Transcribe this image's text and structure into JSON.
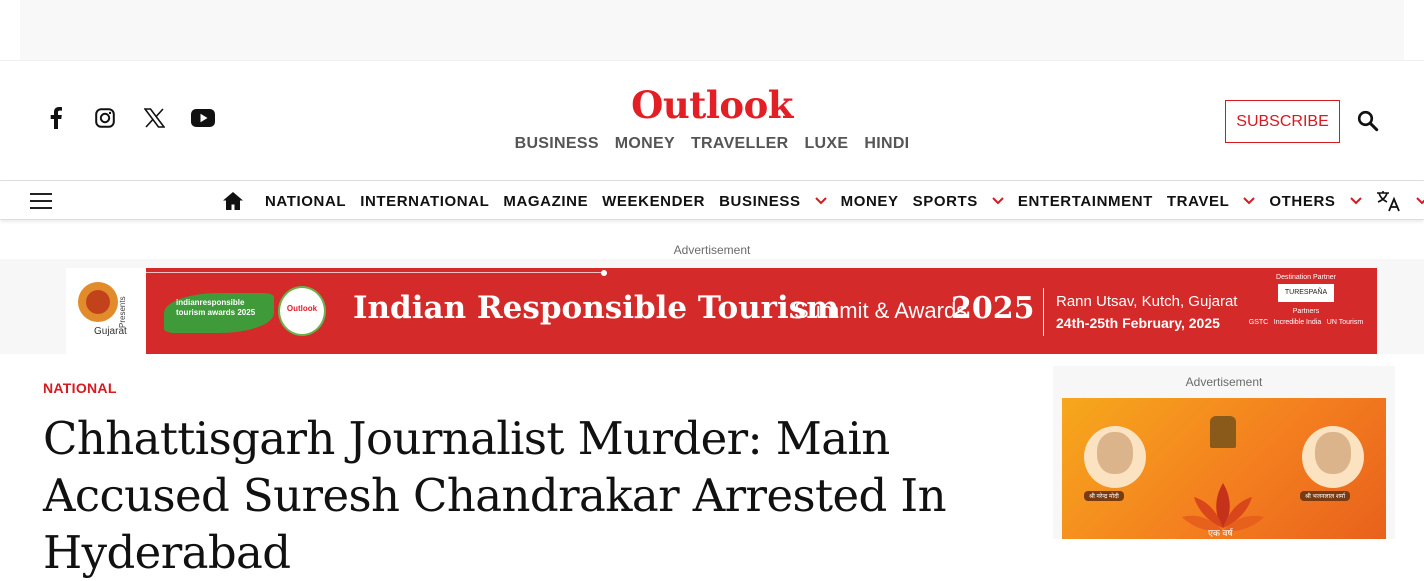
{
  "brand": {
    "logo_text": "Outlook",
    "accent_color": "#e31e24",
    "sub_brands": [
      "BUSINESS",
      "MONEY",
      "TRAVELLER",
      "LUXE",
      "HINDI"
    ]
  },
  "social": {
    "icons": [
      "facebook-icon",
      "instagram-icon",
      "x-icon",
      "youtube-icon"
    ]
  },
  "header": {
    "subscribe_label": "SUBSCRIBE"
  },
  "nav": {
    "items": [
      {
        "label": "NATIONAL",
        "dropdown": false
      },
      {
        "label": "INTERNATIONAL",
        "dropdown": false
      },
      {
        "label": "MAGAZINE",
        "dropdown": false
      },
      {
        "label": "WEEKENDER",
        "dropdown": false
      },
      {
        "label": "BUSINESS",
        "dropdown": true
      },
      {
        "label": "MONEY",
        "dropdown": false
      },
      {
        "label": "SPORTS",
        "dropdown": true
      },
      {
        "label": "ENTERTAINMENT",
        "dropdown": false
      },
      {
        "label": "TRAVEL",
        "dropdown": true
      },
      {
        "label": "OTHERS",
        "dropdown": true
      }
    ]
  },
  "ads": {
    "top_label": "Advertisement",
    "side_label": "Advertisement",
    "banner": {
      "gujarat_label": "Gujarat",
      "presents": "Presents",
      "award_logo_text": "indianresponsible tourism awards 2025",
      "badge_text": "Outlook",
      "title": "Indian Responsible Tourism",
      "summit": "Summit & Awards",
      "year": "2025",
      "location": "Rann Utsav, Kutch, Gujarat",
      "dates": "24th-25th February, 2025",
      "destination_partner_label": "Destination Partner",
      "destination_partner": "TURESPAÑA",
      "partners_label": "Partners",
      "partners": [
        "GSTC",
        "Incredible India",
        "UN Tourism"
      ]
    },
    "side": {
      "caption_left": "श्री नरेन्द्र मोदी",
      "caption_right": "श्री भजनलाल शर्मा",
      "hindi_text": "एक वर्ष"
    }
  },
  "article": {
    "category": "NATIONAL",
    "headline": "Chhattisgarh Journalist Murder: Main Accused Suresh Chandrakar Arrested In Hyderabad"
  }
}
